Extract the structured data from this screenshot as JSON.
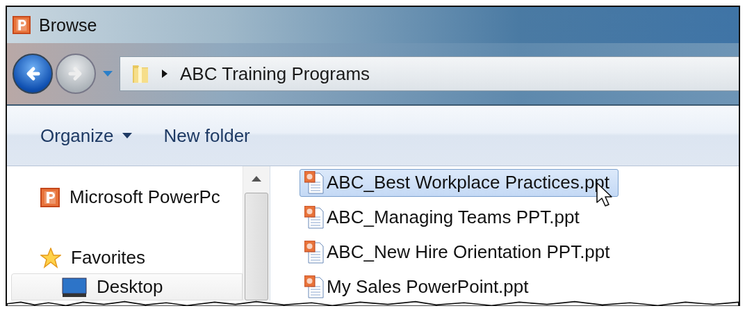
{
  "window": {
    "title": "Browse"
  },
  "address_bar": {
    "path": [
      "ABC Training Programs"
    ]
  },
  "toolbar": {
    "buttons": [
      {
        "label": "Organize",
        "kind": "menu"
      },
      {
        "label": "New folder",
        "kind": "plain"
      }
    ]
  },
  "sidebar": {
    "items": [
      {
        "label": "Microsoft PowerPc",
        "kind": "app",
        "selected": false
      },
      {
        "label": "Favorites",
        "kind": "favorites",
        "selected": false
      },
      {
        "label": "Desktop",
        "kind": "desktop",
        "selected": true
      }
    ]
  },
  "files": [
    {
      "name": "ABC_Best Workplace Practices.ppt",
      "selected": true
    },
    {
      "name": "ABC_Managing Teams PPT.ppt",
      "selected": false
    },
    {
      "name": "ABC_New Hire Orientation PPT.ppt",
      "selected": false
    },
    {
      "name": "My Sales PowerPoint.ppt",
      "selected": false
    }
  ]
}
